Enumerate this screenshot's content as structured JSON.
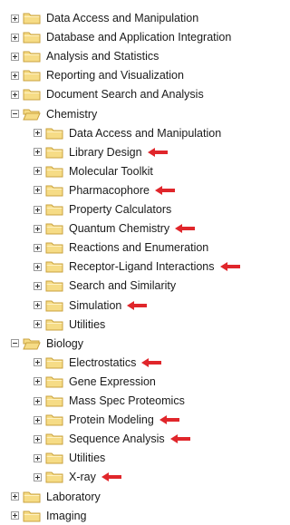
{
  "tree": [
    {
      "label": "Data Access and Manipulation",
      "level": 0,
      "expanded": false,
      "arrow": false
    },
    {
      "label": "Database and Application Integration",
      "level": 0,
      "expanded": false,
      "arrow": false
    },
    {
      "label": "Analysis and Statistics",
      "level": 0,
      "expanded": false,
      "arrow": false
    },
    {
      "label": "Reporting and Visualization",
      "level": 0,
      "expanded": false,
      "arrow": false
    },
    {
      "label": "Document Search and Analysis",
      "level": 0,
      "expanded": false,
      "arrow": false
    },
    {
      "label": "Chemistry",
      "level": 0,
      "expanded": true,
      "arrow": false
    },
    {
      "label": "Data Access and Manipulation",
      "level": 1,
      "expanded": false,
      "arrow": false
    },
    {
      "label": "Library Design",
      "level": 1,
      "expanded": false,
      "arrow": true
    },
    {
      "label": "Molecular Toolkit",
      "level": 1,
      "expanded": false,
      "arrow": false
    },
    {
      "label": "Pharmacophore",
      "level": 1,
      "expanded": false,
      "arrow": true
    },
    {
      "label": "Property Calculators",
      "level": 1,
      "expanded": false,
      "arrow": false
    },
    {
      "label": "Quantum Chemistry",
      "level": 1,
      "expanded": false,
      "arrow": true
    },
    {
      "label": "Reactions and Enumeration",
      "level": 1,
      "expanded": false,
      "arrow": false
    },
    {
      "label": "Receptor-Ligand Interactions",
      "level": 1,
      "expanded": false,
      "arrow": true
    },
    {
      "label": "Search and Similarity",
      "level": 1,
      "expanded": false,
      "arrow": false
    },
    {
      "label": "Simulation",
      "level": 1,
      "expanded": false,
      "arrow": true
    },
    {
      "label": "Utilities",
      "level": 1,
      "expanded": false,
      "arrow": false
    },
    {
      "label": "Biology",
      "level": 0,
      "expanded": true,
      "arrow": false
    },
    {
      "label": "Electrostatics",
      "level": 1,
      "expanded": false,
      "arrow": true
    },
    {
      "label": "Gene Expression",
      "level": 1,
      "expanded": false,
      "arrow": false
    },
    {
      "label": "Mass Spec Proteomics",
      "level": 1,
      "expanded": false,
      "arrow": false
    },
    {
      "label": "Protein Modeling",
      "level": 1,
      "expanded": false,
      "arrow": true
    },
    {
      "label": "Sequence Analysis",
      "level": 1,
      "expanded": false,
      "arrow": true
    },
    {
      "label": "Utilities",
      "level": 1,
      "expanded": false,
      "arrow": false
    },
    {
      "label": "X-ray",
      "level": 1,
      "expanded": false,
      "arrow": true
    },
    {
      "label": "Laboratory",
      "level": 0,
      "expanded": false,
      "arrow": false
    },
    {
      "label": "Imaging",
      "level": 0,
      "expanded": false,
      "arrow": false
    }
  ],
  "icons": {
    "folder": "folder-icon",
    "expander": "expand-collapse-icon",
    "arrow": "red-arrow-icon"
  },
  "colors": {
    "arrow": "#e0262b",
    "folder_fill": "#f6dc86",
    "folder_edge": "#c9a23d"
  }
}
